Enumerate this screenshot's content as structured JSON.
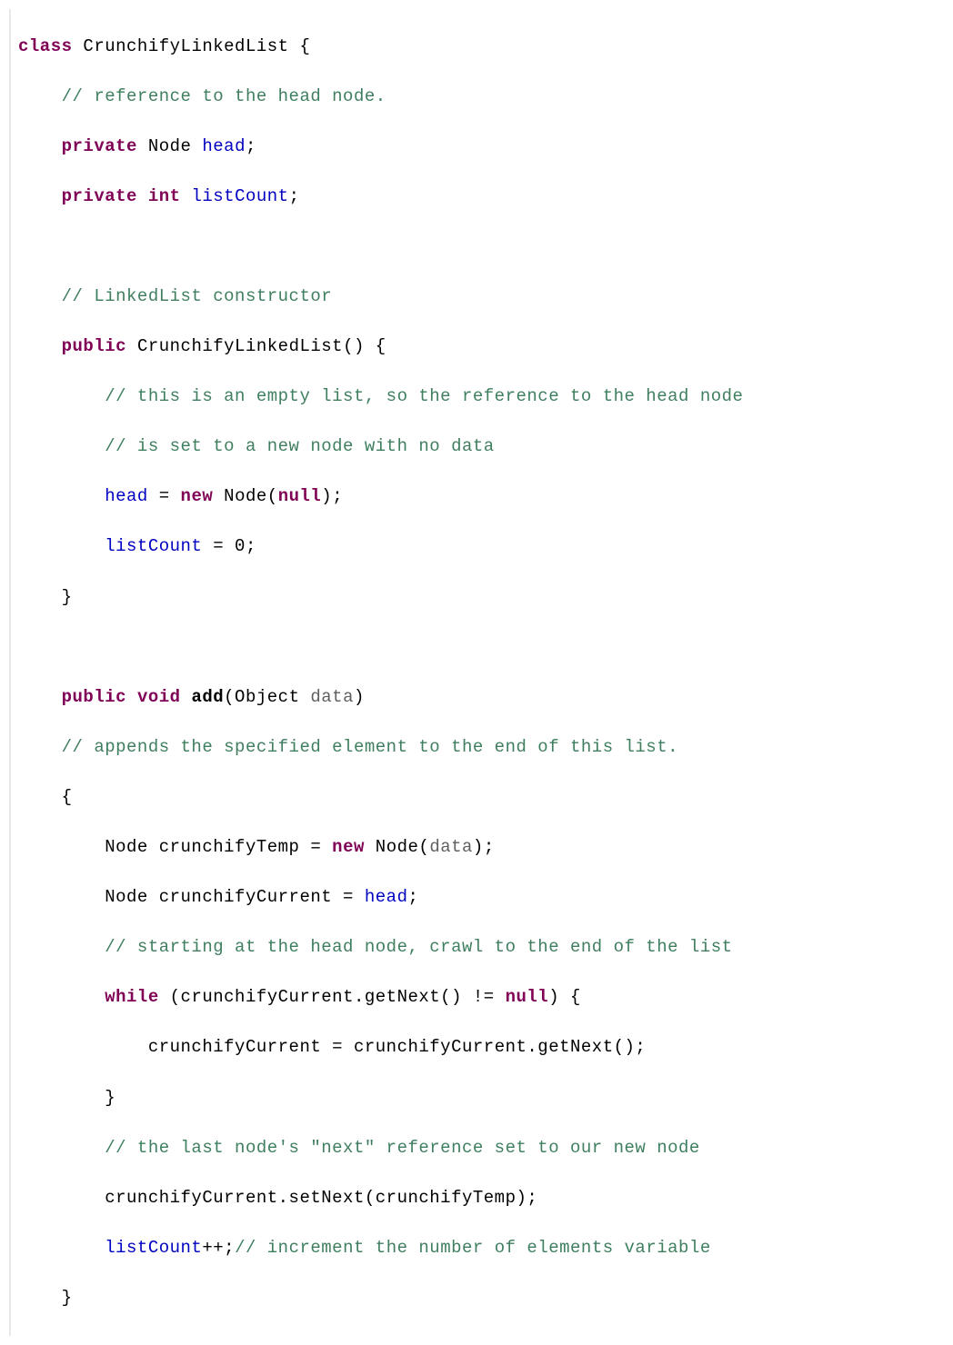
{
  "code": {
    "l1": {
      "kw_class": "class",
      "name": "CrunchifyLinkedList",
      "brace": " {"
    },
    "l2": {
      "c": "// reference to the head node."
    },
    "l3": {
      "kw_private": "private",
      "type": "Node",
      "field": "head",
      "semi": ";"
    },
    "l4": {
      "kw_private": "private",
      "kw_int": "int",
      "field": "listCount",
      "semi": ";"
    },
    "l5": "",
    "l6": {
      "c": "// LinkedList constructor"
    },
    "l7": {
      "kw_public": "public",
      "name": "CrunchifyLinkedList",
      "parens": "() {"
    },
    "l8": {
      "c": "// this is an empty list, so the reference to the head node"
    },
    "l9": {
      "c": "// is set to a new node with no data"
    },
    "l10": {
      "field": "head",
      "eq": " = ",
      "kw_new": "new",
      "type": " Node(",
      "null": "null",
      "close": ");"
    },
    "l11": {
      "field": "listCount",
      "rest": " = 0;"
    },
    "l12": {
      "brace": "}"
    },
    "l13": "",
    "l14": {
      "kw_public": "public",
      "kw_void": "void",
      "name": " add",
      "open": "(Object ",
      "param": "data",
      "close": ")"
    },
    "l15": {
      "c": "// appends the specified element to the end of this list."
    },
    "l16": {
      "brace": "{"
    },
    "l17": {
      "t1": "Node crunchifyTemp = ",
      "kw_new": "new",
      "t2": " Node(",
      "param": "data",
      "t3": ");"
    },
    "l18": {
      "t1": "Node crunchifyCurrent = ",
      "field": "head",
      "t2": ";"
    },
    "l19": {
      "c": "// starting at the head node, crawl to the end of the list"
    },
    "l20": {
      "kw_while": "while",
      "cond_open": " (crunchifyCurrent.getNext() != ",
      "null": "null",
      "cond_close": ") {"
    },
    "l21": {
      "stmt": "crunchifyCurrent = crunchifyCurrent.getNext();"
    },
    "l22": {
      "brace": "}"
    },
    "l23": {
      "c": "// the last node's \"next\" reference set to our new node"
    },
    "l24": {
      "stmt": "crunchifyCurrent.setNext(crunchifyTemp);"
    },
    "l25": {
      "field": "listCount",
      "op": "++;",
      "c": "// increment the number of elements variable"
    },
    "l26": {
      "brace": "}"
    }
  }
}
